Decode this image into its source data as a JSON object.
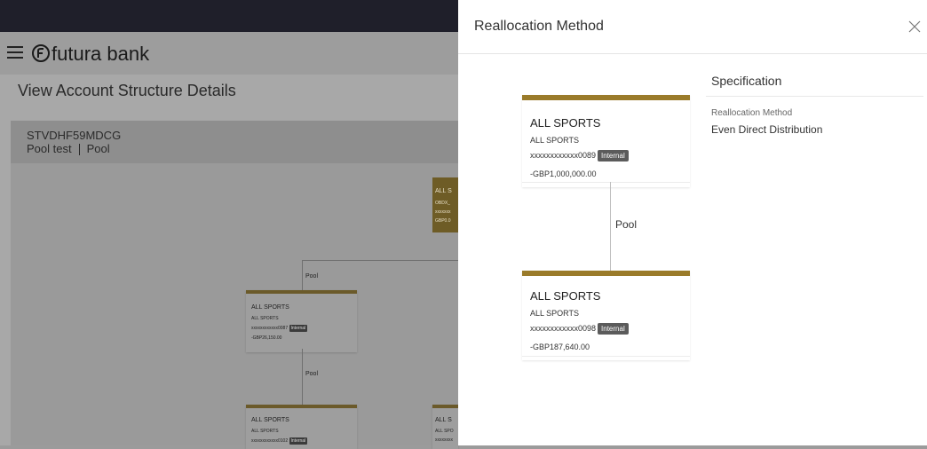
{
  "app": {
    "brand": "futura bank",
    "page_title": "View Account Structure Details"
  },
  "structure": {
    "id": "STVDHF59MDCG",
    "name": "Pool test",
    "type": "Pool"
  },
  "background_tree": {
    "pool_label_top": "Pool",
    "pool_label_mid": "Pool",
    "top_node": {
      "title": "ALL S",
      "line2": "OBDX_",
      "line3": "xxxxxxx",
      "line4": "GBP0.0"
    },
    "mid_node": {
      "title": "ALL SPORTS",
      "sub": "ALL SPORTS",
      "acct": "xxxxxxxxxxxx0087",
      "badge": "Internal",
      "amount": "-GBP26,150.00"
    },
    "bottom_left": {
      "title": "ALL SPORTS",
      "sub": "ALL SPORTS",
      "acct": "xxxxxxxxxxxx0102",
      "badge": "Internal"
    },
    "bottom_right": {
      "title": "ALL S",
      "sub": "ALL SPO",
      "acct": "xxxxxxxx"
    }
  },
  "modal": {
    "title": "Reallocation Method",
    "header_card": {
      "name": "ALL SPORTS",
      "sub": "ALL SPORTS",
      "account": "xxxxxxxxxxxx0089",
      "badge": "Internal",
      "amount": "-GBP1,000,000.00"
    },
    "link_label": "Pool",
    "child_card": {
      "name": "ALL SPORTS",
      "sub": "ALL SPORTS",
      "account": "xxxxxxxxxxxx0098",
      "badge": "Internal",
      "amount": "-GBP187,640.00"
    },
    "specification": {
      "title": "Specification",
      "key": "Reallocation Method",
      "value": "Even Direct Distribution"
    }
  },
  "colors": {
    "card_accent": "#9a7b2a",
    "overlay": "#a8a8a8",
    "badge_bg": "#5b5b5b"
  }
}
